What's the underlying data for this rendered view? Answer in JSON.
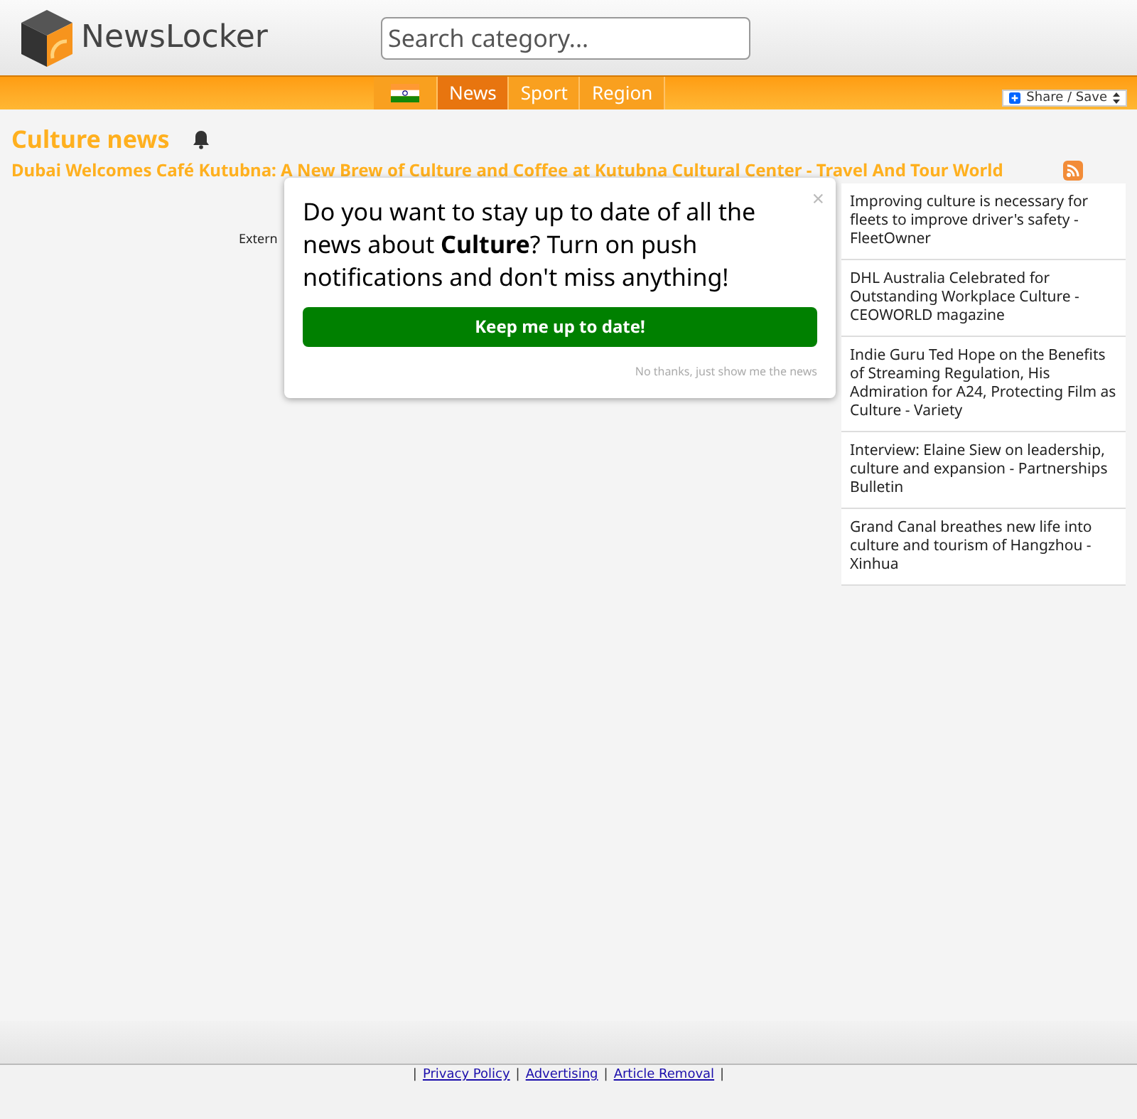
{
  "header": {
    "logo_text": "NewsLocker",
    "search": {
      "placeholder": "Search category..."
    }
  },
  "nav": {
    "items": [
      {
        "kind": "flag",
        "selected": false
      },
      {
        "kind": "link",
        "label": "News",
        "selected": true
      },
      {
        "kind": "link",
        "label": "Sport",
        "selected": false
      },
      {
        "kind": "link",
        "label": "Region",
        "selected": false
      }
    ],
    "share_button": "Share / Save"
  },
  "page": {
    "title": "Culture news",
    "headline": "Dubai Welcomes Café Kutubna: A New Brew of Culture and Coffee at Kutubna Cultural Center - Travel And Tour World",
    "loading_text": "Extern"
  },
  "sidebar": {
    "items": [
      "Improving culture is necessary for fleets to improve driver's safety - FleetOwner",
      "DHL Australia Celebrated for Outstanding Workplace Culture - CEOWORLD magazine",
      "Indie Guru Ted Hope on the Benefits of Streaming Regulation, His Admiration for A24, Protecting Film as Culture - Variety",
      "Interview: Elaine Siew on leadership, culture and expansion - Partnerships Bulletin",
      "Grand Canal breathes new life into culture and tourism of Hangzhou - Xinhua"
    ]
  },
  "modal": {
    "close": "×",
    "message": "Do you want to stay up to date of all the news about **Culture**? Turn on push notifications and don't miss anything!",
    "confirm_button": "Keep me up to date!",
    "dismiss_link": "No thanks, just show me the news"
  },
  "footer": {
    "separator": "|",
    "links": [
      "Privacy Policy",
      "Advertising",
      "Article Removal"
    ]
  }
}
